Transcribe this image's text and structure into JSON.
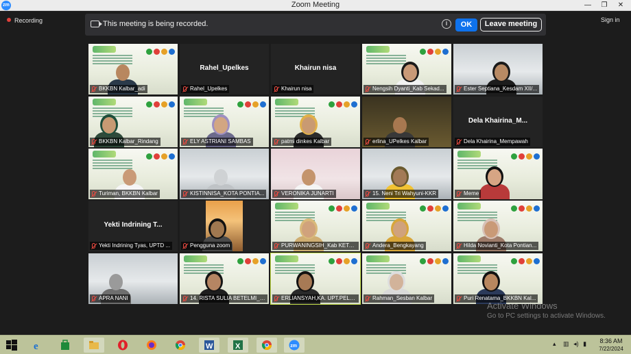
{
  "window": {
    "title": "Zoom Meeting",
    "minimize": "—",
    "restore": "❐",
    "close": "✕",
    "app_badge": "zm"
  },
  "top_left": {
    "recording": "Recording"
  },
  "top_right": {
    "sign_in": "Sign in"
  },
  "banner": {
    "message": "This meeting is being recorded.",
    "info_glyph": "i",
    "ok": "OK",
    "leave": "Leave meeting"
  },
  "participants": [
    {
      "name": "BKKBN Kalbar_adi",
      "center": ""
    },
    {
      "name": "Rahel_Upelkes",
      "center": "Rahel_Upelkes"
    },
    {
      "name": "Khairun nisa",
      "center": "Khairun nisa"
    },
    {
      "name": "Nengsih Dyanti_Kab Sekad...",
      "center": ""
    },
    {
      "name": "Ester Septiana_Kesdam XII/...",
      "center": ""
    },
    {
      "name": "BKKBN Kalbar_Rindang",
      "center": ""
    },
    {
      "name": "ELY ASTRIANI SAMBAS",
      "center": ""
    },
    {
      "name": "patmi dinkes Kalbar",
      "center": ""
    },
    {
      "name": "erlina_UPelkes Kalbar",
      "center": ""
    },
    {
      "name": "Dela Khairina_Mempawah",
      "center": "Dela  Khairina_M..."
    },
    {
      "name": "Turiman, BKKBN Kalbar",
      "center": ""
    },
    {
      "name": "KISTINNISA_KOTA PONTIA...",
      "center": ""
    },
    {
      "name": "VERONIKA JUNARTI",
      "center": ""
    },
    {
      "name": "15. Neni Tri Wahyuni-KKR",
      "center": ""
    },
    {
      "name": "Meme",
      "center": ""
    },
    {
      "name": "Yekti Indrining Tyas, UPTD ...",
      "center": "Yekti  Indrining  T..."
    },
    {
      "name": "Pengguna zoom",
      "center": ""
    },
    {
      "name": "PURWANINGSIH_Kab KETA...",
      "center": ""
    },
    {
      "name": "Andera_Bengkayang",
      "center": ""
    },
    {
      "name": "Hilda Novianti_Kota Pontian...",
      "center": ""
    },
    {
      "name": "APRA NANI",
      "center": ""
    },
    {
      "name": "14. RISTA SULIA BETELMI_K...",
      "center": ""
    },
    {
      "name": "ERLIANSYAH,KA. UPT.PELKES",
      "center": ""
    },
    {
      "name": "Rahman_Sesban Kalbar",
      "center": ""
    },
    {
      "name": "Puri Renatama_BKKBN Kal...",
      "center": ""
    }
  ],
  "watermark": {
    "title": "Activate Windows",
    "subtitle": "Go to PC settings to activate Windows."
  },
  "taskbar": {
    "apps": [
      "windows-start",
      "internet-explorer",
      "store",
      "file-explorer",
      "opera",
      "firefox",
      "chrome",
      "word",
      "excel",
      "chrome",
      "zoom"
    ],
    "clock_time": "8:36 AM",
    "clock_date": "7/22/2024"
  }
}
